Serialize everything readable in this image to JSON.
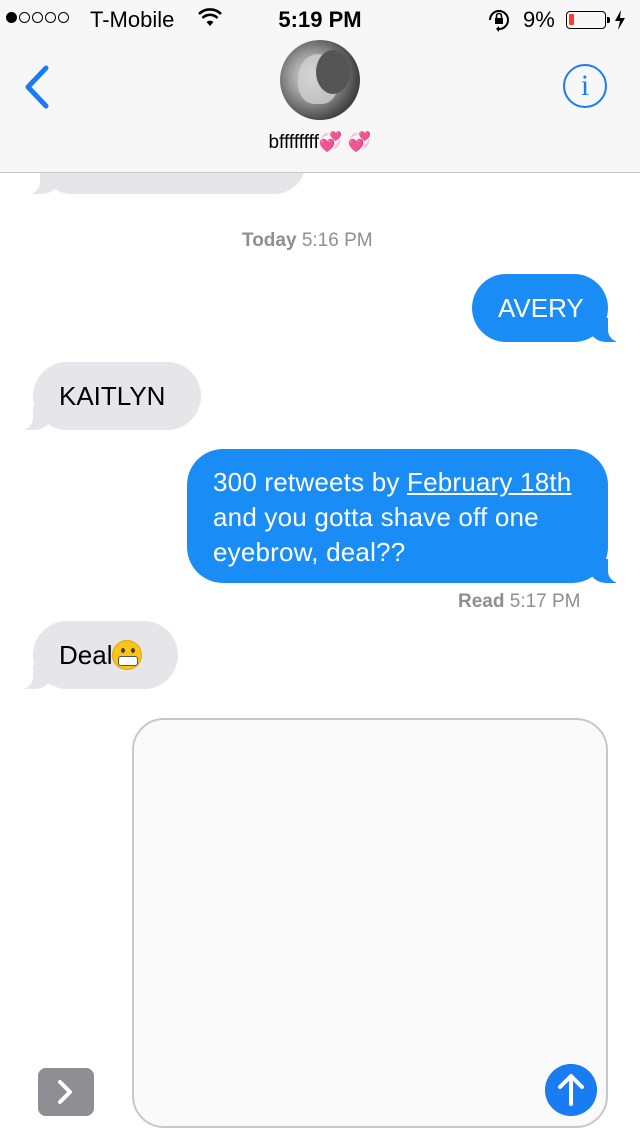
{
  "status_bar": {
    "carrier": "T-Mobile",
    "time": "5:19 PM",
    "battery_percent": "9%",
    "battery_level": 0.09,
    "signal_bars_filled": 1,
    "signal_bars_total": 5,
    "icons": [
      "wifi-icon",
      "orientation-lock-icon",
      "battery-icon",
      "charging-bolt-icon"
    ]
  },
  "header": {
    "contact_name": "bffffffff",
    "name_emoji": [
      "💞",
      "💞"
    ],
    "icons": [
      "back-chevron-icon",
      "avatar",
      "info-icon"
    ],
    "info_glyph": "i",
    "accent_color": "#1a7cf3"
  },
  "conversation": {
    "timestamp_1": {
      "label": "Today",
      "time": "5:16 PM"
    },
    "messages": [
      {
        "from": "me",
        "text": "AVERY"
      },
      {
        "from": "them",
        "text": "KAITLYN"
      },
      {
        "from": "me",
        "text_before": "300 retweets by ",
        "link": "February 18th",
        "text_after": " and you gotta shave off one eyebrow, deal??"
      },
      {
        "from": "them",
        "text": "Deal",
        "emoji": "grimacing-face"
      }
    ],
    "receipt": {
      "label": "Read",
      "time": "5:17 PM"
    },
    "colors": {
      "outgoing": "#1a8cf6",
      "incoming": "#e5e5ea"
    }
  },
  "input": {
    "placeholder": "",
    "icons": [
      "expand-chevron-icon",
      "send-arrow-icon"
    ]
  }
}
